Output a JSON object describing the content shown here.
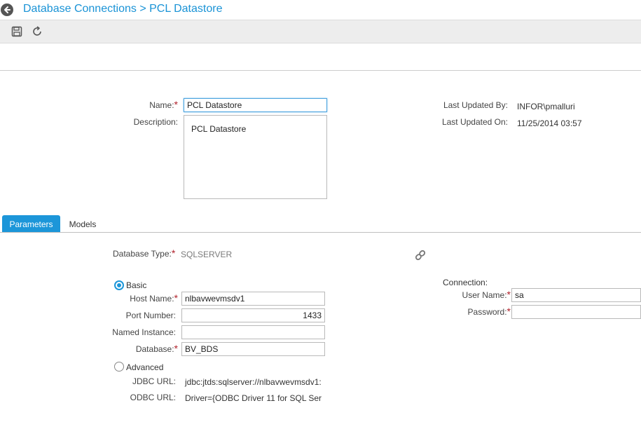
{
  "breadcrumb": {
    "parent": "Database Connections",
    "separator": " > ",
    "current": "PCL Datastore"
  },
  "toolbar": {
    "save_icon": "save-icon",
    "refresh_icon": "refresh-icon"
  },
  "form": {
    "name_label": "Name:",
    "name_value": "PCL Datastore",
    "description_label": "Description:",
    "description_value": "PCL Datastore",
    "last_updated_by_label": "Last Updated By:",
    "last_updated_by_value": "INFOR\\pmalluri",
    "last_updated_on_label": "Last Updated On:",
    "last_updated_on_value": "11/25/2014 03:57",
    "required_marker": "*"
  },
  "tabs": [
    {
      "label": "Parameters",
      "active": true
    },
    {
      "label": "Models",
      "active": false
    }
  ],
  "parameters": {
    "database_type_label": "Database Type:",
    "database_type_value": "SQLSERVER",
    "link_icon": "link-icon",
    "basic_label": "Basic",
    "host_name_label": "Host Name:",
    "host_name_value": "nlbavwevmsdv1",
    "port_number_label": "Port Number:",
    "port_number_value": "1433",
    "named_instance_label": "Named Instance:",
    "named_instance_value": "",
    "database_label": "Database:",
    "database_value": "BV_BDS",
    "advanced_label": "Advanced",
    "jdbc_url_label": "JDBC URL:",
    "jdbc_url_value": "jdbc:jtds:sqlserver://nlbavwevmsdv1:",
    "odbc_url_label": "ODBC URL:",
    "odbc_url_value": "Driver={ODBC Driver 11 for SQL Ser",
    "connection_label": "Connection:",
    "user_name_label": "User Name:",
    "user_name_value": "sa",
    "password_label": "Password:",
    "password_value": ""
  },
  "colors": {
    "accent": "#1c96d9",
    "required": "#b0202a",
    "toolbar_bg": "#ededed"
  }
}
